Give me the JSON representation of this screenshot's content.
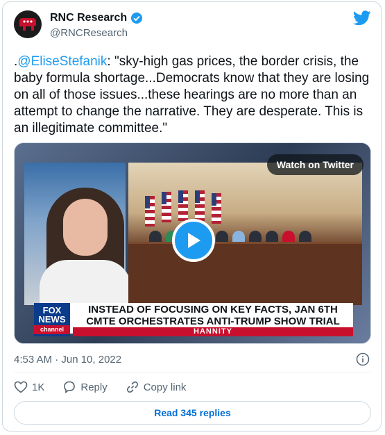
{
  "account": {
    "name": "RNC Research",
    "handle": "@RNCResearch",
    "verified": true
  },
  "tweet": {
    "prefix": ".",
    "mention": "@EliseStefanik",
    "body": ": \"sky-high gas prices, the border crisis, the baby formula shortage...Democrats know that they are losing on all of those issues...these hearings are no more than an attempt to change the narrative. They are desperate. This is an illegitimate committee.\""
  },
  "media": {
    "watch_label": "Watch on Twitter",
    "network_logo_top": "FOX",
    "network_logo_mid": "NEWS",
    "network_logo_bottom": "channel",
    "headline": "INSTEAD OF FOCUSING ON KEY FACTS, JAN 6TH CMTE ORCHESTRATES ANTI-TRUMP SHOW TRIAL",
    "show_name": "HANNITY"
  },
  "meta": {
    "timestamp": "4:53 AM · Jun 10, 2022"
  },
  "actions": {
    "likes": "1K",
    "reply": "Reply",
    "copy_link": "Copy link"
  },
  "read_replies": "Read 345 replies",
  "colors": {
    "accent": "#1d9bf0",
    "link": "#006fd6",
    "muted": "#536471"
  }
}
